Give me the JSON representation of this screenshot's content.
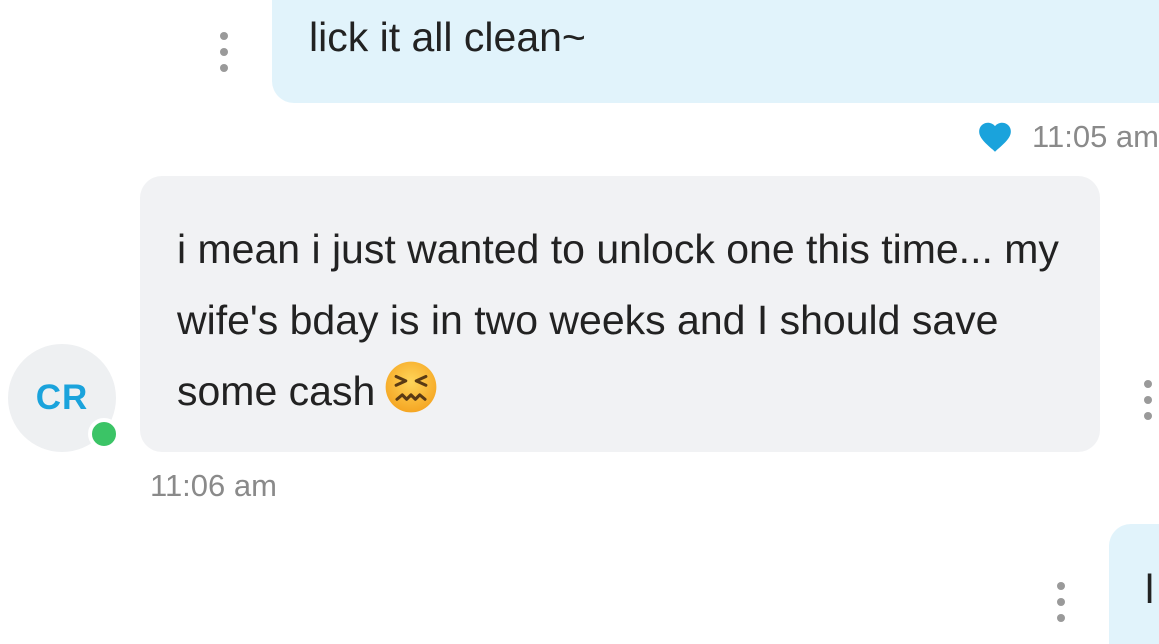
{
  "messages": {
    "outgoing_top": {
      "text": "lick it all clean~",
      "time": "11:05 am",
      "liked": true
    },
    "incoming": {
      "text": "i mean i just wanted to unlock one this time... my wife's bday is in two weeks and I should save some cash",
      "emoji": "confounded-face-emoji",
      "time": "11:06 am",
      "sender_initials": "CR",
      "sender_online": true
    },
    "outgoing_bottom": {
      "text": "l"
    }
  },
  "icons": {
    "like": "heart-icon",
    "more": "more-options-icon",
    "presence": "online-status-dot"
  },
  "colors": {
    "outgoing_bubble": "#e1f3fb",
    "incoming_bubble": "#f1f2f4",
    "heart": "#1aa3dc",
    "initials": "#1aa3dc",
    "online": "#3bc466",
    "timestamp": "#8a8a8a"
  }
}
